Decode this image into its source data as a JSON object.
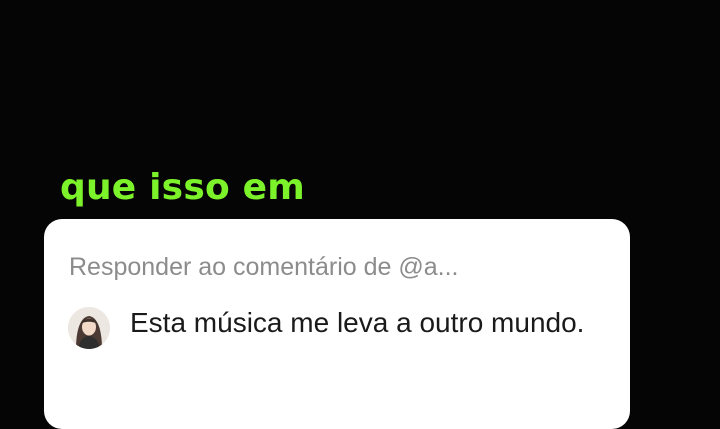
{
  "caption": {
    "text": "que isso em",
    "color": "#7CF22A"
  },
  "reply_card": {
    "header": "Responder ao comentário de @a...",
    "comment": {
      "avatar_icon": "user-avatar",
      "text": "Esta música me leva a outro mundo."
    }
  },
  "colors": {
    "background": "#050505",
    "card": "#FFFFFF",
    "header_text": "#8C8C8C",
    "comment_text": "#1A1A1A"
  }
}
